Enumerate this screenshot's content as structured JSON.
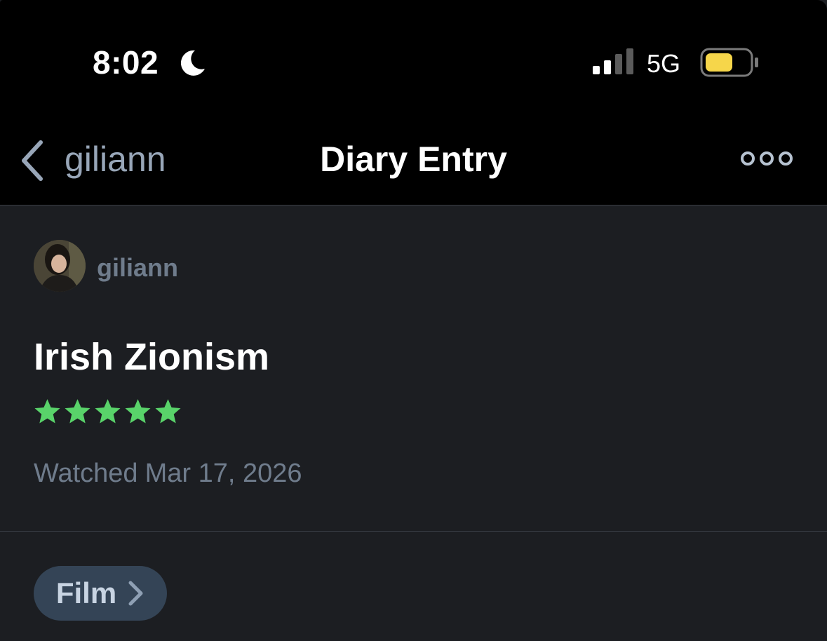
{
  "status_bar": {
    "time": "8:02",
    "network": "5G",
    "icons": [
      "moon-icon",
      "signal-bars-icon",
      "battery-icon"
    ],
    "battery_color": "#f6d64a"
  },
  "nav": {
    "back_label": "giliann",
    "title": "Diary Entry",
    "more_icon": "more-dots-icon"
  },
  "entry": {
    "username": "giliann",
    "film_title": "Irish Zionism",
    "rating": 5,
    "rating_max": 5,
    "star_color": "#59d36a",
    "watched_label": "Watched",
    "watched_date": "Mar 17, 2026"
  },
  "chip": {
    "label": "Film"
  }
}
